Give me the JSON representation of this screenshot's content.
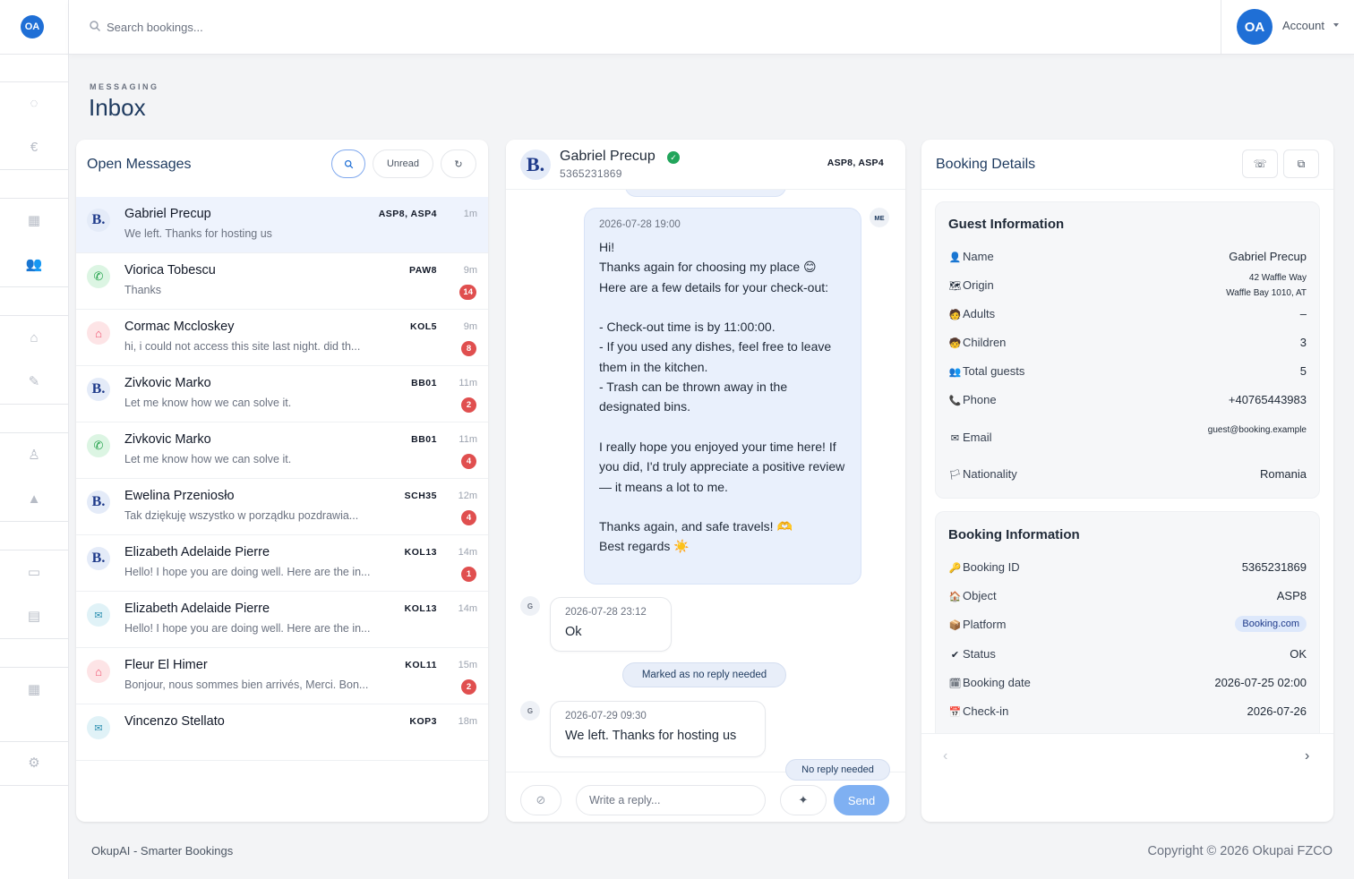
{
  "app": {
    "logo_text": "OA",
    "search_placeholder": "Search bookings...",
    "account_initials": "OA",
    "account_label": "Account"
  },
  "header": {
    "overline": "MESSAGING",
    "title": "Inbox"
  },
  "sidebar_icons": [
    "refresh-icon",
    "euro-icon",
    "building-icon",
    "users-icon",
    "home-icon",
    "user-edit-icon",
    "user-tie-icon",
    "warning-icon",
    "inbox-tray-icon",
    "chat-icon",
    "calendar-icon",
    "settings-icon"
  ],
  "open_messages": {
    "title": "Open Messages",
    "unread_label": "Unread",
    "items": [
      {
        "channel": "booking",
        "initial": "B.",
        "name": "Gabriel Precup",
        "preview": "We left. Thanks for hosting us",
        "code": "ASP8, ASP4",
        "time": "1m",
        "badge": "",
        "active": true
      },
      {
        "channel": "whatsapp",
        "initial": "✆",
        "name": "Viorica Tobescu",
        "preview": "Thanks",
        "code": "PAW8",
        "time": "9m",
        "badge": "14",
        "active": false
      },
      {
        "channel": "airbnb",
        "initial": "⌂",
        "name": "Cormac Mccloskey",
        "preview": "hi, i could not access this site last night. did th...",
        "code": "KOL5",
        "time": "9m",
        "badge": "8",
        "active": false
      },
      {
        "channel": "booking",
        "initial": "B.",
        "name": "Zivkovic Marko",
        "preview": "Let me know how we can solve it.",
        "code": "BB01",
        "time": "11m",
        "badge": "2",
        "active": false
      },
      {
        "channel": "whatsapp",
        "initial": "✆",
        "name": "Zivkovic Marko",
        "preview": "Let me know how we can solve it.",
        "code": "BB01",
        "time": "11m",
        "badge": "4",
        "active": false
      },
      {
        "channel": "booking",
        "initial": "B.",
        "name": "Ewelina Przeniosło",
        "preview": "Tak dziękuję wszystko w porządku pozdrawia...",
        "code": "SCH35",
        "time": "12m",
        "badge": "4",
        "active": false
      },
      {
        "channel": "booking",
        "initial": "B.",
        "name": "Elizabeth Adelaide Pierre",
        "preview": "Hello! I hope you are doing well. Here are the in...",
        "code": "KOL13",
        "time": "14m",
        "badge": "1",
        "active": false
      },
      {
        "channel": "email",
        "initial": "✉",
        "name": "Elizabeth Adelaide Pierre",
        "preview": "Hello! I hope you are doing well. Here are the in...",
        "code": "KOL13",
        "time": "14m",
        "badge": "",
        "active": false
      },
      {
        "channel": "airbnb",
        "initial": "⌂",
        "name": "Fleur El Himer",
        "preview": "Bonjour, nous sommes bien arrivés, Merci. Bon...",
        "code": "KOL11",
        "time": "15m",
        "badge": "2",
        "active": false
      },
      {
        "channel": "email",
        "initial": "✉",
        "name": "Vincenzo Stellato",
        "preview": "",
        "code": "KOP3",
        "time": "18m",
        "badge": "",
        "active": false
      }
    ]
  },
  "chat": {
    "avatar_initial": "B.",
    "name": "Gabriel Precup",
    "subtitle": "5365231869",
    "code": "ASP8, ASP4",
    "me_tag": "ME",
    "guest_tag": "G",
    "outgoing": {
      "time": "2026-07-28 19:00",
      "text": "Hi!\nThanks again for choosing my place 😊\nHere are a few details for your check-out:\n\n- Check-out time is by 11:00:00.\n- If you used any dishes, feel free to leave them in the kitchen.\n- Trash can be thrown away in the designated bins.\n\nI really hope you enjoyed your time here! If you did, I'd truly appreciate a positive review — it means a lot to me.\n\nThanks again, and safe travels! 🫶\nBest regards ☀️"
    },
    "incoming_1": {
      "time": "2026-07-28 23:12",
      "text": "Ok"
    },
    "system_label": "Marked as no reply needed",
    "incoming_2": {
      "time": "2026-07-29 09:30",
      "text": "We left. Thanks for hosting us"
    },
    "no_reply_label": "No reply needed",
    "reply_placeholder": "Write a reply...",
    "send_label": "Send"
  },
  "booking_details": {
    "title": "Booking Details",
    "guest_info": {
      "title": "Guest Information",
      "rows": [
        {
          "icon": "👤",
          "label": "Name",
          "value": "Gabriel Precup"
        },
        {
          "icon": "🗺",
          "label": "Origin",
          "value": "42 Waffle Way\nWaffle Bay 1010, AT"
        },
        {
          "icon": "🧑",
          "label": "Adults",
          "value": "–"
        },
        {
          "icon": "🧒",
          "label": "Children",
          "value": "3"
        },
        {
          "icon": "👥",
          "label": "Total guests",
          "value": "5"
        },
        {
          "icon": "📞",
          "label": "Phone",
          "value": "+40765443983"
        },
        {
          "icon": "✉",
          "label": "Email",
          "value": "guest@booking.example"
        },
        {
          "icon": "🏳",
          "label": "Nationality",
          "value": "Romania"
        }
      ]
    },
    "booking_info": {
      "title": "Booking Information",
      "rows": [
        {
          "icon": "🔑",
          "label": "Booking ID",
          "value": "5365231869"
        },
        {
          "icon": "🏠",
          "label": "Object",
          "value": "ASP8"
        },
        {
          "icon": "📦",
          "label": "Platform",
          "value": "Booking.com"
        },
        {
          "icon": "✔",
          "label": "Status",
          "value": "OK"
        },
        {
          "icon": "🗓",
          "label": "Booking date",
          "value": "2026-07-25 02:00"
        },
        {
          "icon": "📅",
          "label": "Check-in",
          "value": "2026-07-26"
        }
      ]
    }
  },
  "footer": {
    "left": "OkupAI - Smarter Bookings",
    "right": "Copyright © 2026 Okupai FZCO"
  },
  "colors": {
    "primary": "#1f6fd6",
    "send": "#7fb0f2",
    "badge": "#e04f4f",
    "active_row": "#eef3fd",
    "verified": "#22a55b"
  }
}
